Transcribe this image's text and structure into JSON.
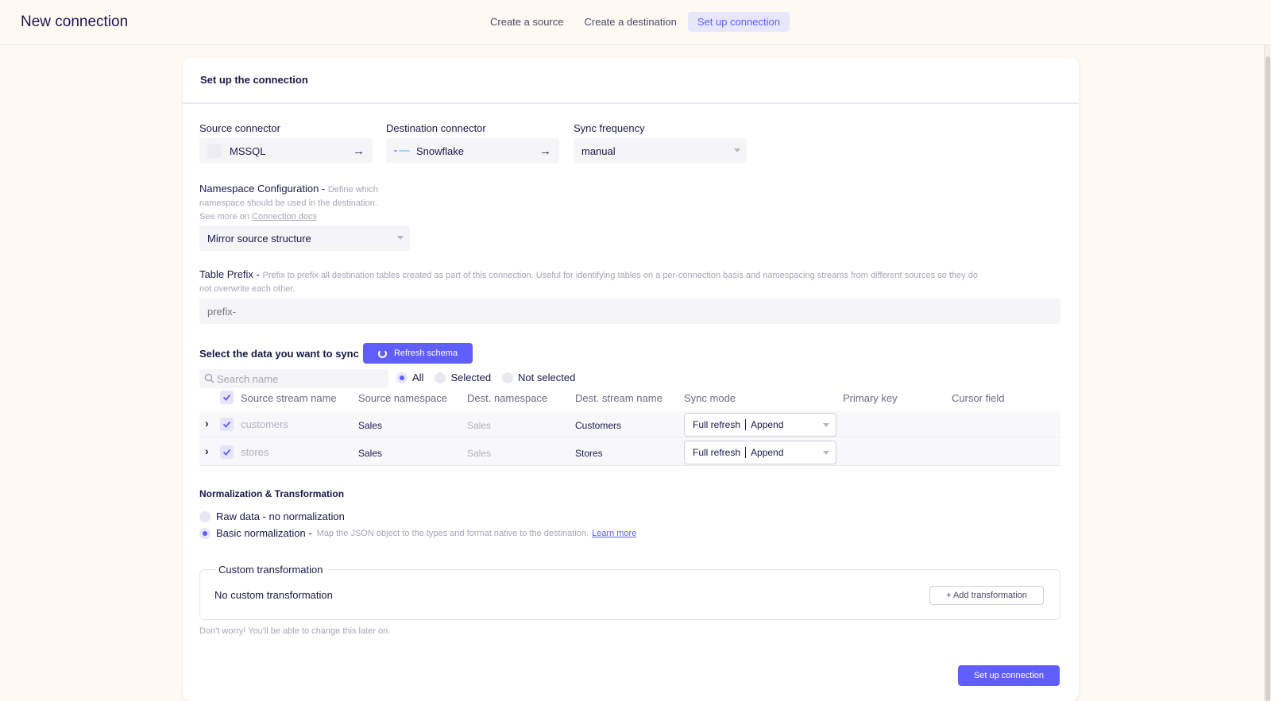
{
  "header": {
    "title": "New connection",
    "steps": [
      "Create a source",
      "Create a destination",
      "Set up connection"
    ]
  },
  "card": {
    "title": "Set up the connection"
  },
  "source": {
    "label": "Source connector",
    "value": "MSSQL"
  },
  "destination": {
    "label": "Destination connector",
    "value": "Snowflake"
  },
  "frequency": {
    "label": "Sync frequency",
    "value": "manual"
  },
  "namespace": {
    "label": "Namespace Configuration - ",
    "hint_1": "Define which",
    "hint_2": "namespace should be used in the destination.",
    "hint_3": "See more on ",
    "link": "Connection docs",
    "value": "Mirror source structure"
  },
  "prefix": {
    "label": "Table Prefix - ",
    "hint_1": "Prefix to prefix all destination tables created as part of this connection. Useful for identifying tables on a per-connection basis and namespacing streams from different sources so they do",
    "hint_2": "not overwrite each other.",
    "placeholder": "prefix-"
  },
  "sync": {
    "title": "Select the data you want to sync",
    "refresh_label": "Refresh schema",
    "search_placeholder": "Search name",
    "filters": [
      "All",
      "Selected",
      "Not selected"
    ],
    "selected_filter": "All",
    "columns": [
      "Source stream name",
      "Source namespace",
      "Dest. namespace",
      "Dest. stream name",
      "Sync mode",
      "Primary key",
      "Cursor field"
    ],
    "rows": [
      {
        "name": "customers",
        "source_ns": "Sales",
        "dest_ns": "Sales",
        "dest_name": "Customers",
        "mode_a": "Full refresh",
        "mode_b": "Append"
      },
      {
        "name": "stores",
        "source_ns": "Sales",
        "dest_ns": "Sales",
        "dest_name": "Stores",
        "mode_a": "Full refresh",
        "mode_b": "Append"
      }
    ]
  },
  "normalization": {
    "title": "Normalization & Transformation",
    "raw_label": "Raw data - no normalization",
    "basic_label": "Basic normalization - ",
    "basic_hint": "Map the JSON object to the types and format native to the destination.",
    "learn_more": "Learn more",
    "selected": "Basic normalization"
  },
  "custom": {
    "legend": "Custom transformation",
    "empty": "No custom transformation",
    "add_label": "+ Add transformation",
    "note": "Don't worry! You'll be able to change this later on."
  },
  "submit": {
    "label": "Set up connection"
  },
  "colors": {
    "accent": "#615eff",
    "background": "#fef9f3"
  }
}
